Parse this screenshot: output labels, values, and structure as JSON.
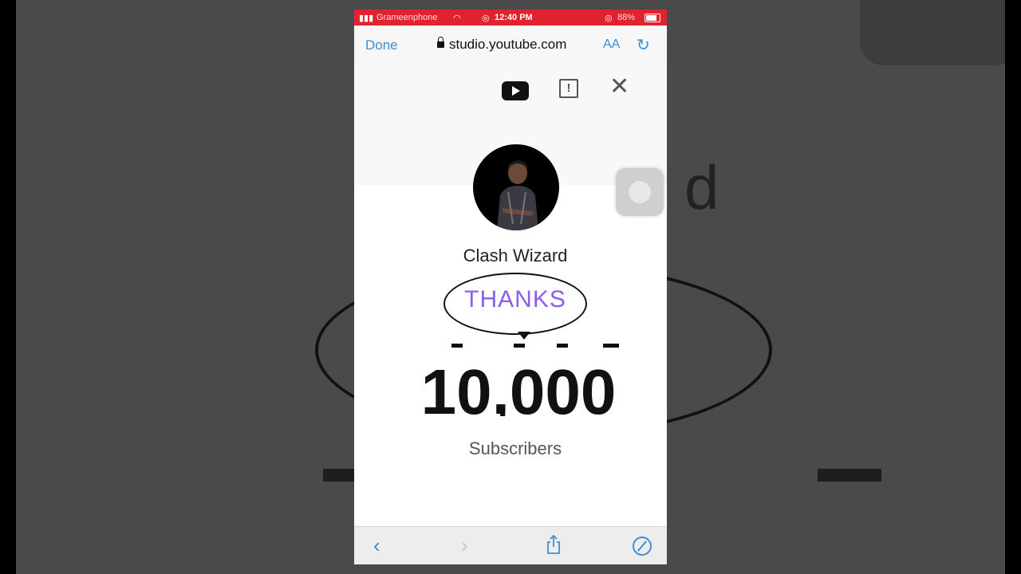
{
  "status_bar": {
    "carrier": "Grameenphone",
    "time": "12:40 PM",
    "battery": "88%"
  },
  "browser": {
    "done_label": "Done",
    "url": "studio.youtube.com",
    "text_size_label": "AA"
  },
  "page": {
    "channel_name": "Clash Wizard",
    "bubble_text": "THANKS",
    "count": "10,000",
    "count_label": "Subscribers"
  },
  "colors": {
    "status_bar": "#e0232e",
    "accent": "#3b8ed6",
    "thanks": "#8b5cf6"
  },
  "icons": [
    "youtube-icon",
    "feedback-icon",
    "close-icon",
    "back-icon",
    "forward-icon",
    "share-icon",
    "compass-icon"
  ],
  "background": {
    "partial_letter": "d"
  }
}
